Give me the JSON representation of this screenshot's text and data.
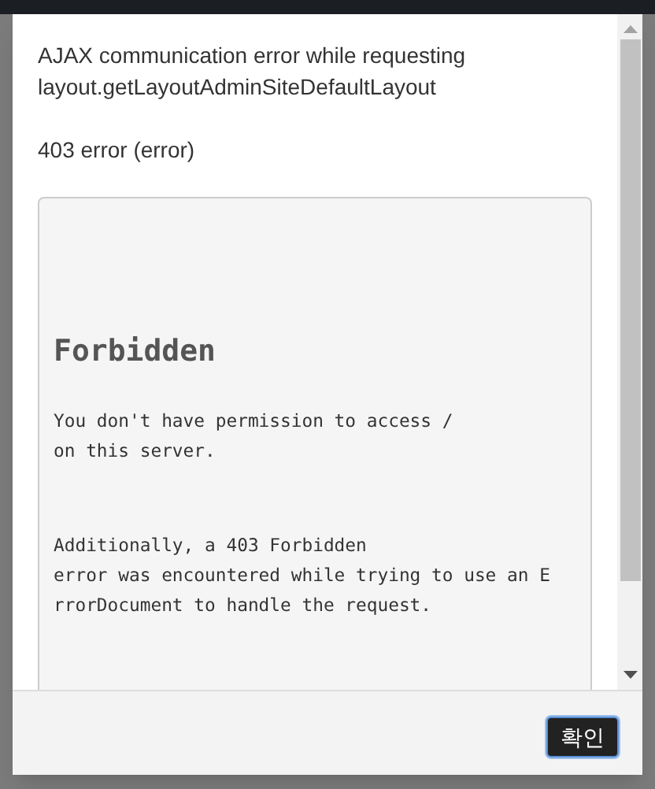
{
  "dialog": {
    "message_lines": [
      "AJAX communication error while requesting",
      "layout.getLayoutAdminSiteDefaultLayout"
    ],
    "status": "403 error (error)",
    "response": {
      "heading": "Forbidden",
      "paragraphs": [
        [
          "You don't have permission to access /",
          "on this server."
        ],
        [
          "Additionally, a 403 Forbidden",
          "error was encountered while trying to use an E",
          "rrorDocument to handle the request."
        ]
      ]
    },
    "buttons": [
      "확인"
    ]
  }
}
